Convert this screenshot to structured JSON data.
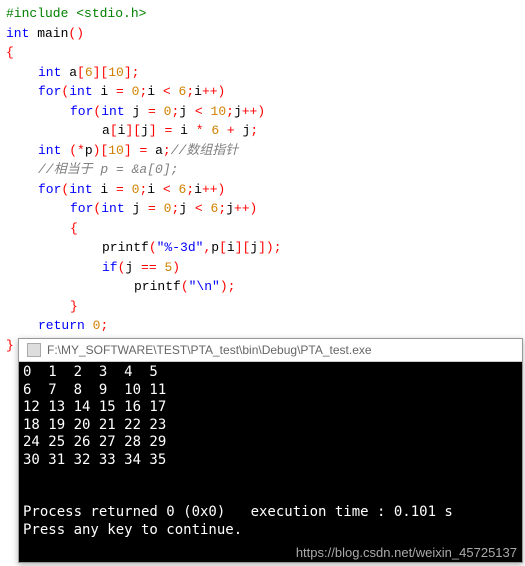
{
  "code": {
    "l1a": "#include ",
    "l1b": "<stdio.h>",
    "l2a": "int",
    "l2b": " main",
    "l2c": "()",
    "l3": "{",
    "l4a": "int",
    "l4b": " a",
    "l4c": "[",
    "l4d": "6",
    "l4e": "][",
    "l4f": "10",
    "l4g": "];",
    "l5a": "for",
    "l5b": "(",
    "l5c": "int",
    "l5d": " i ",
    "l5e": "=",
    "l5f": " ",
    "l5g": "0",
    "l5h": ";",
    "l5i": "i ",
    "l5j": "<",
    "l5k": " ",
    "l5l": "6",
    "l5m": ";",
    "l5n": "i",
    "l5o": "++)",
    "l6a": "for",
    "l6b": "(",
    "l6c": "int",
    "l6d": " j ",
    "l6e": "=",
    "l6f": " ",
    "l6g": "0",
    "l6h": ";",
    "l6i": "j ",
    "l6j": "<",
    "l6k": " ",
    "l6l": "10",
    "l6m": ";",
    "l6n": "j",
    "l6o": "++)",
    "l7a": "a",
    "l7b": "[",
    "l7c": "i",
    "l7d": "][",
    "l7e": "j",
    "l7f": "] = ",
    "l7g": "i ",
    "l7h": "*",
    "l7i": " ",
    "l7j": "6",
    "l7k": " + ",
    "l7l": "j",
    "l7m": ";",
    "l8a": "int",
    "l8b": " ",
    "l8c": "(*",
    "l8d": "p",
    "l8e": ")[",
    "l8f": "10",
    "l8g": "] = ",
    "l8h": "a",
    "l8i": ";",
    "l8j": "//数组指针",
    "l9": "//相当于 p = &a[0];",
    "l10a": "for",
    "l10b": "(",
    "l10c": "int",
    "l10d": " i ",
    "l10e": "=",
    "l10f": " ",
    "l10g": "0",
    "l10h": ";",
    "l10i": "i ",
    "l10j": "<",
    "l10k": " ",
    "l10l": "6",
    "l10m": ";",
    "l10n": "i",
    "l10o": "++)",
    "l11a": "for",
    "l11b": "(",
    "l11c": "int",
    "l11d": " j ",
    "l11e": "=",
    "l11f": " ",
    "l11g": "0",
    "l11h": ";",
    "l11i": "j ",
    "l11j": "<",
    "l11k": " ",
    "l11l": "6",
    "l11m": ";",
    "l11n": "j",
    "l11o": "++)",
    "l12": "{",
    "l13a": "printf",
    "l13b": "(",
    "l13c": "\"%-3d\"",
    "l13d": ",",
    "l13e": "p",
    "l13f": "[",
    "l13g": "i",
    "l13h": "][",
    "l13i": "j",
    "l13j": "]);",
    "l14a": "if",
    "l14b": "(",
    "l14c": "j ",
    "l14d": "==",
    "l14e": " ",
    "l14f": "5",
    "l14g": ")",
    "l15a": "printf",
    "l15b": "(",
    "l15c": "\"\\n\"",
    "l15d": ");",
    "l16": "}",
    "l17a": "return",
    "l17b": " ",
    "l17c": "0",
    "l17d": ";",
    "l18": "}"
  },
  "console": {
    "title": "F:\\MY_SOFTWARE\\TEST\\PTA_test\\bin\\Debug\\PTA_test.exe",
    "output": "0  1  2  3  4  5\n6  7  8  9  10 11\n12 13 14 15 16 17\n18 19 20 21 22 23\n24 25 26 27 28 29\n30 31 32 33 34 35\n\n\nProcess returned 0 (0x0)   execution time : 0.101 s\nPress any key to continue."
  },
  "watermark": "https://blog.csdn.net/weixin_45725137"
}
